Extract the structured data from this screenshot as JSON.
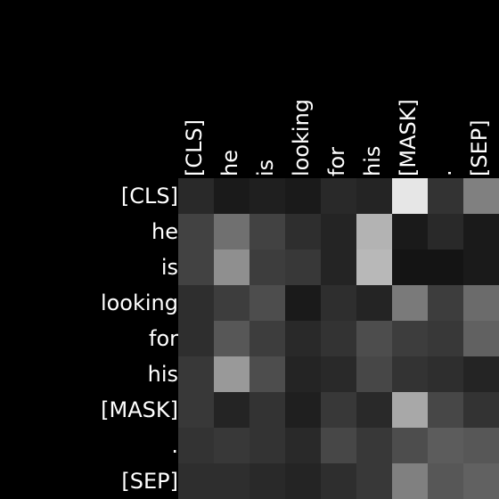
{
  "chart_data": {
    "type": "heatmap",
    "x_labels": [
      "[CLS]",
      "he",
      "is",
      "looking",
      "for",
      "his",
      "[MASK]",
      ".",
      "[SEP]"
    ],
    "y_labels": [
      "[CLS]",
      "he",
      "is",
      "looking",
      "for",
      "his",
      "[MASK]",
      ".",
      "[SEP]"
    ],
    "colormap": "greys",
    "values": [
      [
        0.08,
        0.05,
        0.06,
        0.05,
        0.08,
        0.07,
        0.45,
        0.1,
        0.25
      ],
      [
        0.13,
        0.22,
        0.13,
        0.09,
        0.07,
        0.35,
        0.05,
        0.08,
        0.05
      ],
      [
        0.13,
        0.28,
        0.12,
        0.11,
        0.07,
        0.36,
        0.04,
        0.04,
        0.05
      ],
      [
        0.09,
        0.12,
        0.15,
        0.05,
        0.09,
        0.07,
        0.24,
        0.12,
        0.21
      ],
      [
        0.09,
        0.17,
        0.12,
        0.08,
        0.1,
        0.15,
        0.12,
        0.11,
        0.19
      ],
      [
        0.11,
        0.3,
        0.15,
        0.07,
        0.08,
        0.14,
        0.1,
        0.09,
        0.07
      ],
      [
        0.11,
        0.07,
        0.1,
        0.06,
        0.11,
        0.08,
        0.33,
        0.14,
        0.1
      ],
      [
        0.1,
        0.11,
        0.1,
        0.08,
        0.14,
        0.11,
        0.15,
        0.18,
        0.17
      ],
      [
        0.09,
        0.09,
        0.08,
        0.07,
        0.09,
        0.11,
        0.25,
        0.17,
        0.19
      ]
    ],
    "max_value": 0.5
  }
}
